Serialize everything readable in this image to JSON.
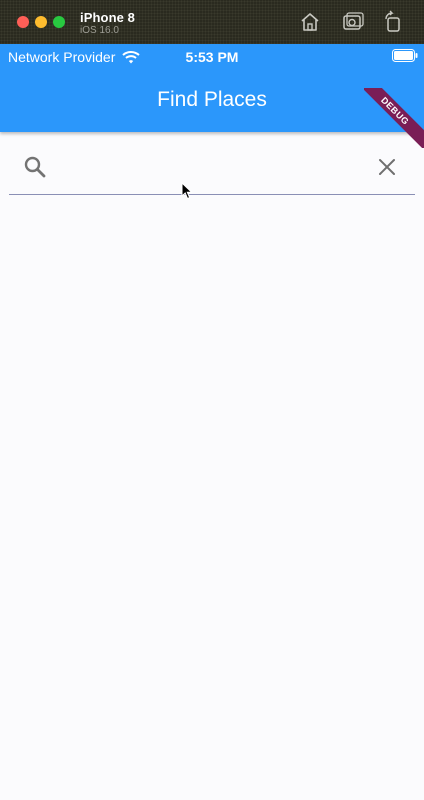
{
  "simulator": {
    "device_name": "iPhone 8",
    "os_version": "iOS 16.0"
  },
  "status_bar": {
    "carrier": "Network Provider",
    "time": "5:53 PM"
  },
  "app_bar": {
    "title": "Find Places",
    "debug_banner": "DEBUG",
    "color": "#2b97fb"
  },
  "search": {
    "value": "",
    "placeholder": ""
  },
  "icons": {
    "home": "home-icon",
    "screenshot": "screenshot-icon",
    "rotate": "rotate-icon",
    "wifi": "wifi-icon",
    "battery": "battery-icon",
    "search": "search-icon",
    "clear": "close-icon"
  }
}
